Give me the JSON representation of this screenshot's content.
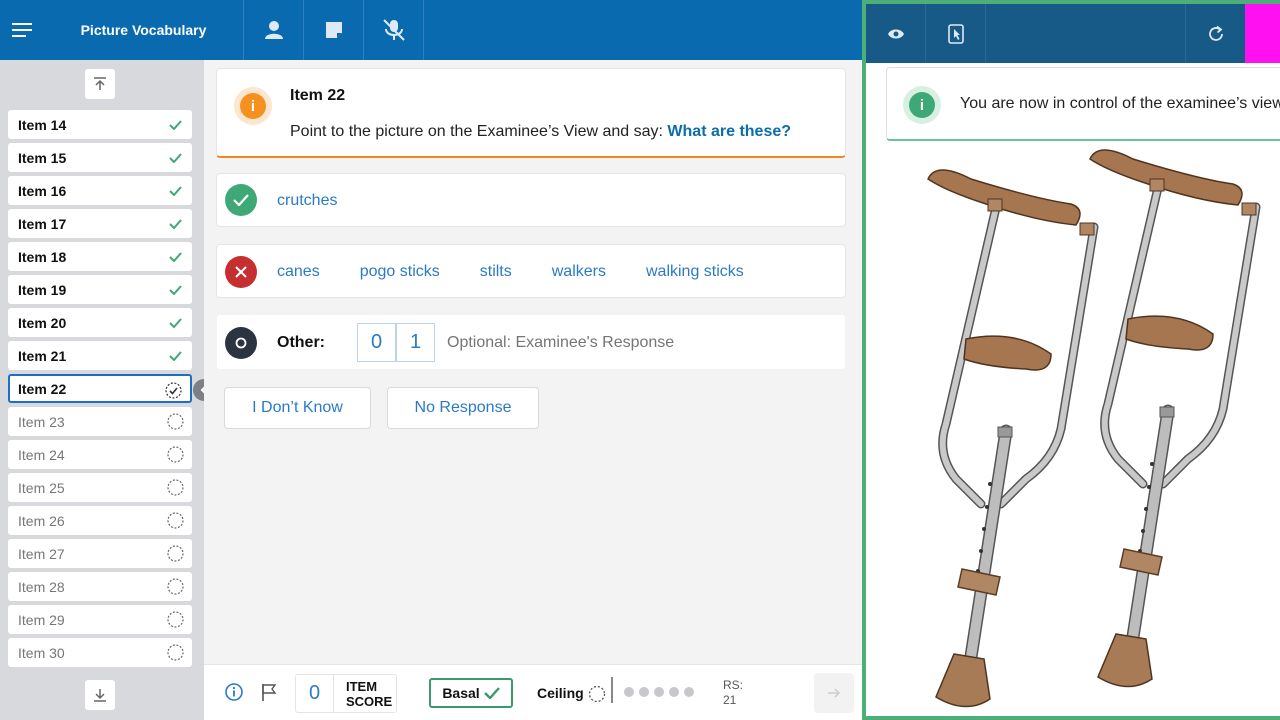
{
  "header": {
    "title": "Picture Vocabulary",
    "icons": [
      "menu-icon",
      "person-icon",
      "note-icon",
      "mic-off-icon"
    ]
  },
  "sidebar": {
    "items": [
      {
        "label": "Item 14",
        "status": "done"
      },
      {
        "label": "Item 15",
        "status": "done"
      },
      {
        "label": "Item 16",
        "status": "done"
      },
      {
        "label": "Item 17",
        "status": "done"
      },
      {
        "label": "Item 18",
        "status": "done"
      },
      {
        "label": "Item 19",
        "status": "done"
      },
      {
        "label": "Item 20",
        "status": "done"
      },
      {
        "label": "Item 21",
        "status": "done"
      },
      {
        "label": "Item 22",
        "status": "current"
      },
      {
        "label": "Item 23",
        "status": "todo"
      },
      {
        "label": "Item 24",
        "status": "todo"
      },
      {
        "label": "Item 25",
        "status": "todo"
      },
      {
        "label": "Item 26",
        "status": "todo"
      },
      {
        "label": "Item 27",
        "status": "todo"
      },
      {
        "label": "Item 28",
        "status": "todo"
      },
      {
        "label": "Item 29",
        "status": "todo"
      },
      {
        "label": "Item 30",
        "status": "todo"
      }
    ]
  },
  "prompt": {
    "title": "Item 22",
    "instruction": "Point to the picture on the Examinee’s View and say: ",
    "question": "What are these?"
  },
  "correct_answers": [
    "crutches"
  ],
  "incorrect_answers": [
    "canes",
    "pogo sticks",
    "stilts",
    "walkers",
    "walking sticks"
  ],
  "other": {
    "label": "Other:",
    "scores": [
      "0",
      "1"
    ],
    "placeholder": "Optional: Examinee's Response"
  },
  "buttons": {
    "dont_know": "I Don’t Know",
    "no_response": "No Response"
  },
  "footer": {
    "item_score_value": "0",
    "item_score_label_line1": "ITEM",
    "item_score_label_line2": "SCORE",
    "basal_label": "Basal",
    "ceiling_label": "Ceiling",
    "ceiling_dots": 5,
    "rs_label": "RS:",
    "rs_value": "21"
  },
  "examinee_view": {
    "banner": "You are now in control of the examinee’s view",
    "icons": [
      "eye-icon",
      "tablet-pointer-icon",
      "refresh-icon"
    ],
    "accent_color": "#ff10f0",
    "stimulus": "two crutches"
  },
  "colors": {
    "header_blue": "#0a6ab0",
    "right_header": "#175a88",
    "correct_green": "#3fa877",
    "incorrect_red": "#c62f2f",
    "link_blue": "#2a7ac8",
    "prompt_orange": "#f5911f"
  }
}
